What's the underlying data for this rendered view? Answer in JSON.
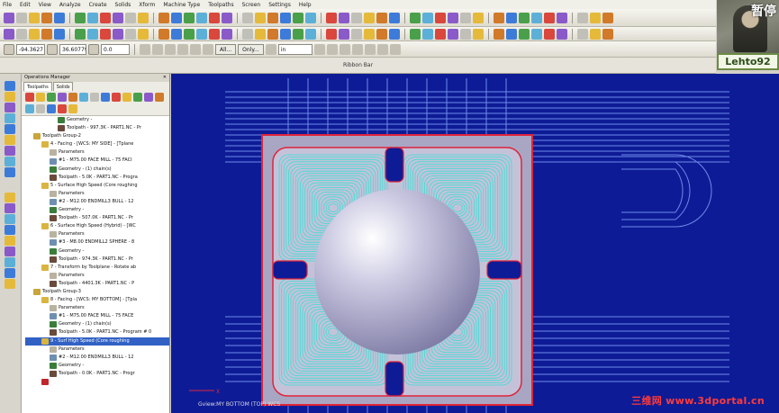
{
  "menu": [
    "File",
    "Edit",
    "View",
    "Analyze",
    "Create",
    "Solids",
    "Xform",
    "Machine Type",
    "Toolpaths",
    "Screen",
    "Settings",
    "Help"
  ],
  "inputs": {
    "x_value": "-94.3627",
    "y_value": "36.60779",
    "z_value": "0.0",
    "all_button": "All...",
    "only_button": "Only...",
    "units": "in"
  },
  "ribbon_label": "Ribbon Bar",
  "webcam": {
    "pause_text": "暂停",
    "name_tag": "Lehto92"
  },
  "operations": {
    "title": "Operations Manager",
    "tabs": [
      "Toolpaths",
      "Solids"
    ],
    "tree": [
      {
        "indent": 4,
        "text": "Geometry -",
        "icon": "#3a7d3a"
      },
      {
        "indent": 4,
        "text": "Toolpath - 997.3K - PART1.NC - Pr",
        "icon": "#6a4a3a"
      },
      {
        "indent": 1,
        "text": "Toolpath Group-2",
        "icon": "#c9a53a"
      },
      {
        "indent": 2,
        "text": "4 - Facing - [WCS: MY SIDE] - [Tplane",
        "icon": "#d9b441"
      },
      {
        "indent": 3,
        "text": "Parameters",
        "icon": "#b8b2a0"
      },
      {
        "indent": 3,
        "text": "#1 - M75.00 FACE MILL - 75 FACI",
        "icon": "#6f8fb0"
      },
      {
        "indent": 3,
        "text": "Geometry - (1) chain(s)",
        "icon": "#3a7d3a"
      },
      {
        "indent": 3,
        "text": "Toolpath - 5.0K - PART1.NC - Progra",
        "icon": "#6a4a3a"
      },
      {
        "indent": 2,
        "text": "5 - Surface High Speed (Core roughing",
        "icon": "#d9b441"
      },
      {
        "indent": 3,
        "text": "Parameters",
        "icon": "#b8b2a0"
      },
      {
        "indent": 3,
        "text": "#2 - M12.00 ENDMILL3 BULL - 12",
        "icon": "#6f8fb0"
      },
      {
        "indent": 3,
        "text": "Geometry -",
        "icon": "#3a7d3a"
      },
      {
        "indent": 3,
        "text": "Toolpath - 507.0K - PART1.NC - Pr",
        "icon": "#6a4a3a"
      },
      {
        "indent": 2,
        "text": "6 - Surface High Speed (Hybrid) - [WC",
        "icon": "#d9b441"
      },
      {
        "indent": 3,
        "text": "Parameters",
        "icon": "#b8b2a0"
      },
      {
        "indent": 3,
        "text": "#3 - M8.00 ENDMILL2 SPHERE - 8",
        "icon": "#6f8fb0"
      },
      {
        "indent": 3,
        "text": "Geometry -",
        "icon": "#3a7d3a"
      },
      {
        "indent": 3,
        "text": "Toolpath - 974.3K - PART1.NC - Pr",
        "icon": "#6a4a3a"
      },
      {
        "indent": 2,
        "text": "7 - Transform by Toolplane - Rotate ab",
        "icon": "#d9b441"
      },
      {
        "indent": 3,
        "text": "Parameters",
        "icon": "#b8b2a0"
      },
      {
        "indent": 3,
        "text": "Toolpath - 4401.3K - PART1.NC - P",
        "icon": "#6a4a3a"
      },
      {
        "indent": 1,
        "text": "Toolpath Group-3",
        "icon": "#c9a53a"
      },
      {
        "indent": 2,
        "text": "8 - Facing - [WCS: MY BOTTOM] - [Tpla",
        "icon": "#d9b441"
      },
      {
        "indent": 3,
        "text": "Parameters",
        "icon": "#b8b2a0"
      },
      {
        "indent": 3,
        "text": "#1 - M75.00 FACE MILL - 75 FACE",
        "icon": "#6f8fb0"
      },
      {
        "indent": 3,
        "text": "Geometry - (1) chain(s)",
        "icon": "#3a7d3a"
      },
      {
        "indent": 3,
        "text": "Toolpath - 5.0K - PART1.NC - Program # 0",
        "icon": "#6a4a3a"
      },
      {
        "indent": 2,
        "text": "9 - Surf   High Speed (Core roughing",
        "icon": "#d9b441",
        "selected": true
      },
      {
        "indent": 3,
        "text": "Parameters",
        "icon": "#b8b2a0"
      },
      {
        "indent": 3,
        "text": "#2 - M12.00 ENDMILL3 BULL - 12",
        "icon": "#6f8fb0"
      },
      {
        "indent": 3,
        "text": "Geometry -",
        "icon": "#3a7d3a"
      },
      {
        "indent": 3,
        "text": "Toolpath - 0.0K - PART1.NC - Progr",
        "icon": "#6a4a3a"
      },
      {
        "indent": 2,
        "text": "",
        "icon": "#c0262c"
      }
    ]
  },
  "viewport": {
    "status": "Gview:MY BOTTOM (TOP)   WCS",
    "watermark": "三维网 www.3dportal.cn",
    "colors": {
      "background": "#0e1b96",
      "stock": "#b9b6cf",
      "toolpath": "#38e0d6",
      "wire": "#6f8be8",
      "boundary": "#e0243a"
    }
  }
}
